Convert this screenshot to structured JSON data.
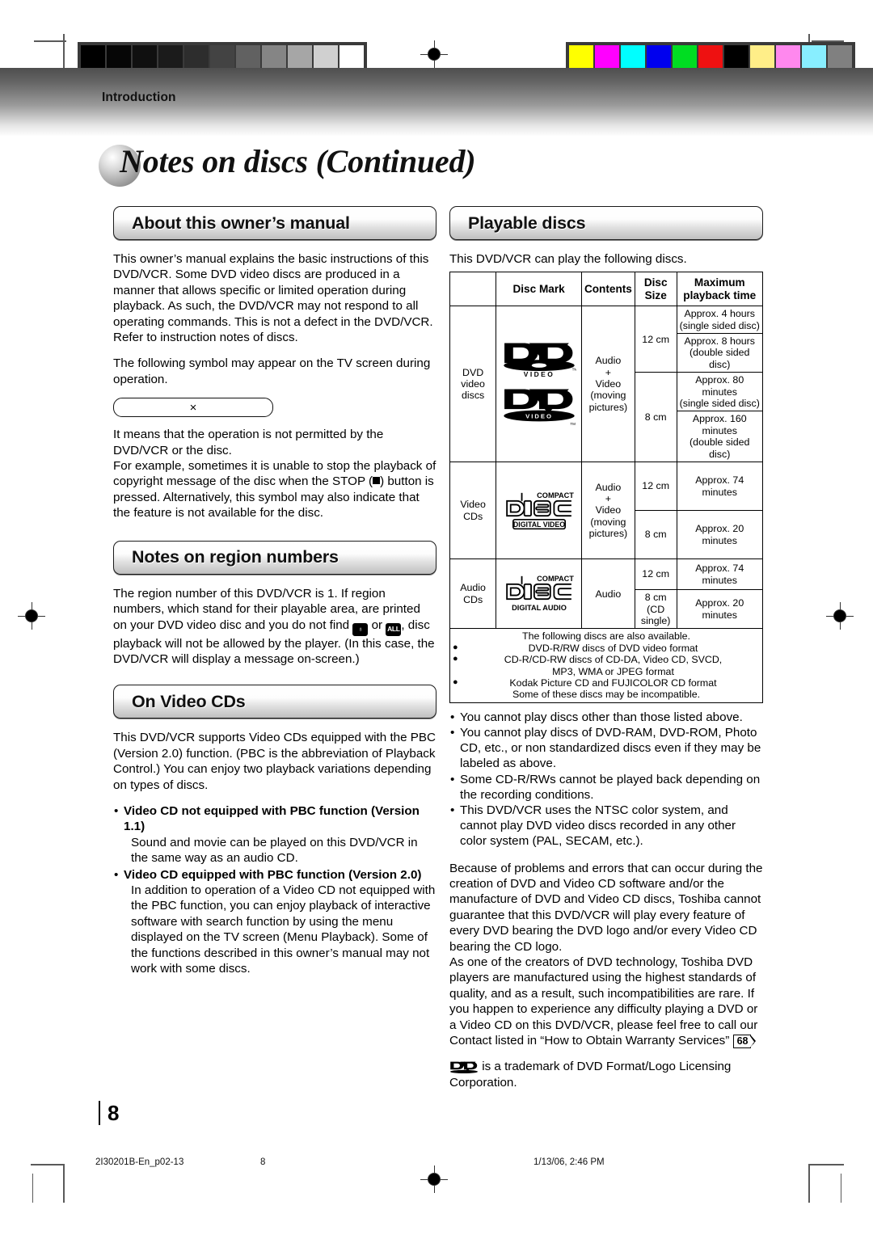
{
  "header": {
    "section_label": "Introduction"
  },
  "page_title": "Notes on discs (Continued)",
  "page_number": "8",
  "left": {
    "s1": {
      "heading": "About this owner’s manual",
      "p1": "This owner’s manual explains the basic instructions of this DVD/VCR. Some DVD video discs are produced in a manner that allows specific or limited operation during playback. As such, the DVD/VCR may not respond to all operating commands. This is not a defect in the DVD/VCR. Refer to instruction notes of discs.",
      "p2": "The following symbol may appear on the TV screen during operation.",
      "symbol": "×",
      "p3a": "It means that the operation is not permitted by the DVD/VCR or the disc.",
      "p3b_1": "For example, sometimes it is unable to stop the playback of copyright message of the disc when the STOP (",
      "p3b_2": ") button is pressed. Alternatively, this symbol may also indicate that the feature is not available for the disc."
    },
    "s2": {
      "heading": "Notes on region numbers",
      "p1_1": "The region number of this DVD/VCR is 1. If region numbers, which stand for their playable area, are printed on your DVD video disc and you do not find",
      "icon1": "♁",
      "p1_2": "or",
      "icon2": "ALL",
      "p1_3": ", disc playback will not be allowed by the player. (In this case, the DVD/VCR will display a message on-screen.)"
    },
    "s3": {
      "heading": "On Video CDs",
      "p1": "This DVD/VCR supports Video CDs equipped with the PBC (Version 2.0) function. (PBC is the abbreviation of Playback Control.) You can enjoy two playback variations depending on types of discs.",
      "bullets": [
        {
          "head": "Video CD not equipped with PBC function (Version 1.1)",
          "sub": "Sound and movie can be played on this DVD/VCR in the same way as an audio CD."
        },
        {
          "head": "Video CD equipped with PBC function (Version 2.0)",
          "sub": "In addition to operation of a Video CD not equipped with the PBC function, you can enjoy playback of interactive software with search function by using the menu displayed on the TV screen (Menu Playback). Some of the functions described in this owner’s manual may not work with some discs."
        }
      ]
    }
  },
  "right": {
    "heading": "Playable discs",
    "intro": "This DVD/VCR can play the following discs.",
    "table": {
      "headers": [
        "",
        "Disc Mark",
        "Contents",
        "Disc Size",
        "Maximum playback time"
      ],
      "rows": [
        {
          "name": "DVD video discs",
          "mark": "dvd-video-logo",
          "contents": "Audio + Video (moving pictures)",
          "sizes": [
            {
              "size": "12 cm",
              "times": [
                "Approx. 4 hours (single sided disc)",
                "Approx. 8 hours (double sided disc)"
              ]
            },
            {
              "size": "8 cm",
              "times": [
                "Approx. 80 minutes (single sided disc)",
                "Approx. 160 minutes (double sided disc)"
              ]
            }
          ]
        },
        {
          "name": "Video CDs",
          "mark": "compact-disc-digital-video-logo",
          "contents": "Audio + Video (moving pictures)",
          "sizes": [
            {
              "size": "12 cm",
              "times": [
                "Approx. 74 minutes"
              ]
            },
            {
              "size": "8 cm",
              "times": [
                "Approx. 20 minutes"
              ]
            }
          ]
        },
        {
          "name": "Audio CDs",
          "mark": "compact-disc-digital-audio-logo",
          "contents": "Audio",
          "sizes": [
            {
              "size": "12 cm",
              "times": [
                "Approx. 74 minutes"
              ]
            },
            {
              "size": "8 cm (CD single)",
              "times": [
                "Approx. 20 minutes"
              ]
            }
          ]
        }
      ],
      "note": {
        "lead": "The following discs are also available.",
        "items": [
          "DVD-R/RW discs of DVD video format",
          "CD-R/CD-RW discs of CD-DA, Video CD, SVCD,",
          "Kodak Picture CD and FUJICOLOR CD format"
        ],
        "item2_cont": "MP3, WMA or JPEG format",
        "tail": "Some of these discs may be incompatible."
      }
    },
    "bullets": [
      "You cannot play discs other than those listed above.",
      "You cannot play discs of DVD-RAM, DVD-ROM, Photo CD, etc., or non standardized discs even if they may be labeled as above.",
      "Some CD-R/RWs cannot be played back depending on the recording conditions.",
      "This DVD/VCR uses the NTSC color system, and cannot play DVD video discs recorded in any other color system (PAL, SECAM, etc.)."
    ],
    "closing_1": "Because of problems and errors that can occur during the creation of DVD and Video CD software and/or the manufacture of DVD and Video CD discs, Toshiba cannot guarantee that this DVD/VCR will play every feature of every DVD bearing the DVD logo and/or every Video CD bearing the CD logo.",
    "closing_2a": "As one of the creators of DVD technology, Toshiba DVD players are manufactured using the highest standards of quality, and as a result, such incompatibilities are rare. If you happen to experience any difficulty playing a DVD or a Video CD on this DVD/VCR, please feel free to call our Contact listed in “How to Obtain Warranty Services”",
    "closing_ref": "68",
    "closing_2b": ".",
    "trademark": "is a trademark of DVD Format/Logo Licensing Corporation."
  },
  "footer": {
    "file": "2I30201B-En_p02-13",
    "page": "8",
    "timestamp": "1/13/06, 2:46 PM"
  },
  "calibration": {
    "gray_swatches": [
      "#000000",
      "#060606",
      "#101010",
      "#1b1b1b",
      "#2d2d2d",
      "#434343",
      "#616161",
      "#858585",
      "#a6a6a6",
      "#d0d0d0",
      "#ffffff"
    ],
    "color_swatches": [
      "#ffff00",
      "#ff00ff",
      "#00ffff",
      "#0000ee",
      "#00dd22",
      "#ee1111",
      "#000000",
      "#ffee88",
      "#ff88ee",
      "#88eeff",
      "#808080"
    ]
  }
}
